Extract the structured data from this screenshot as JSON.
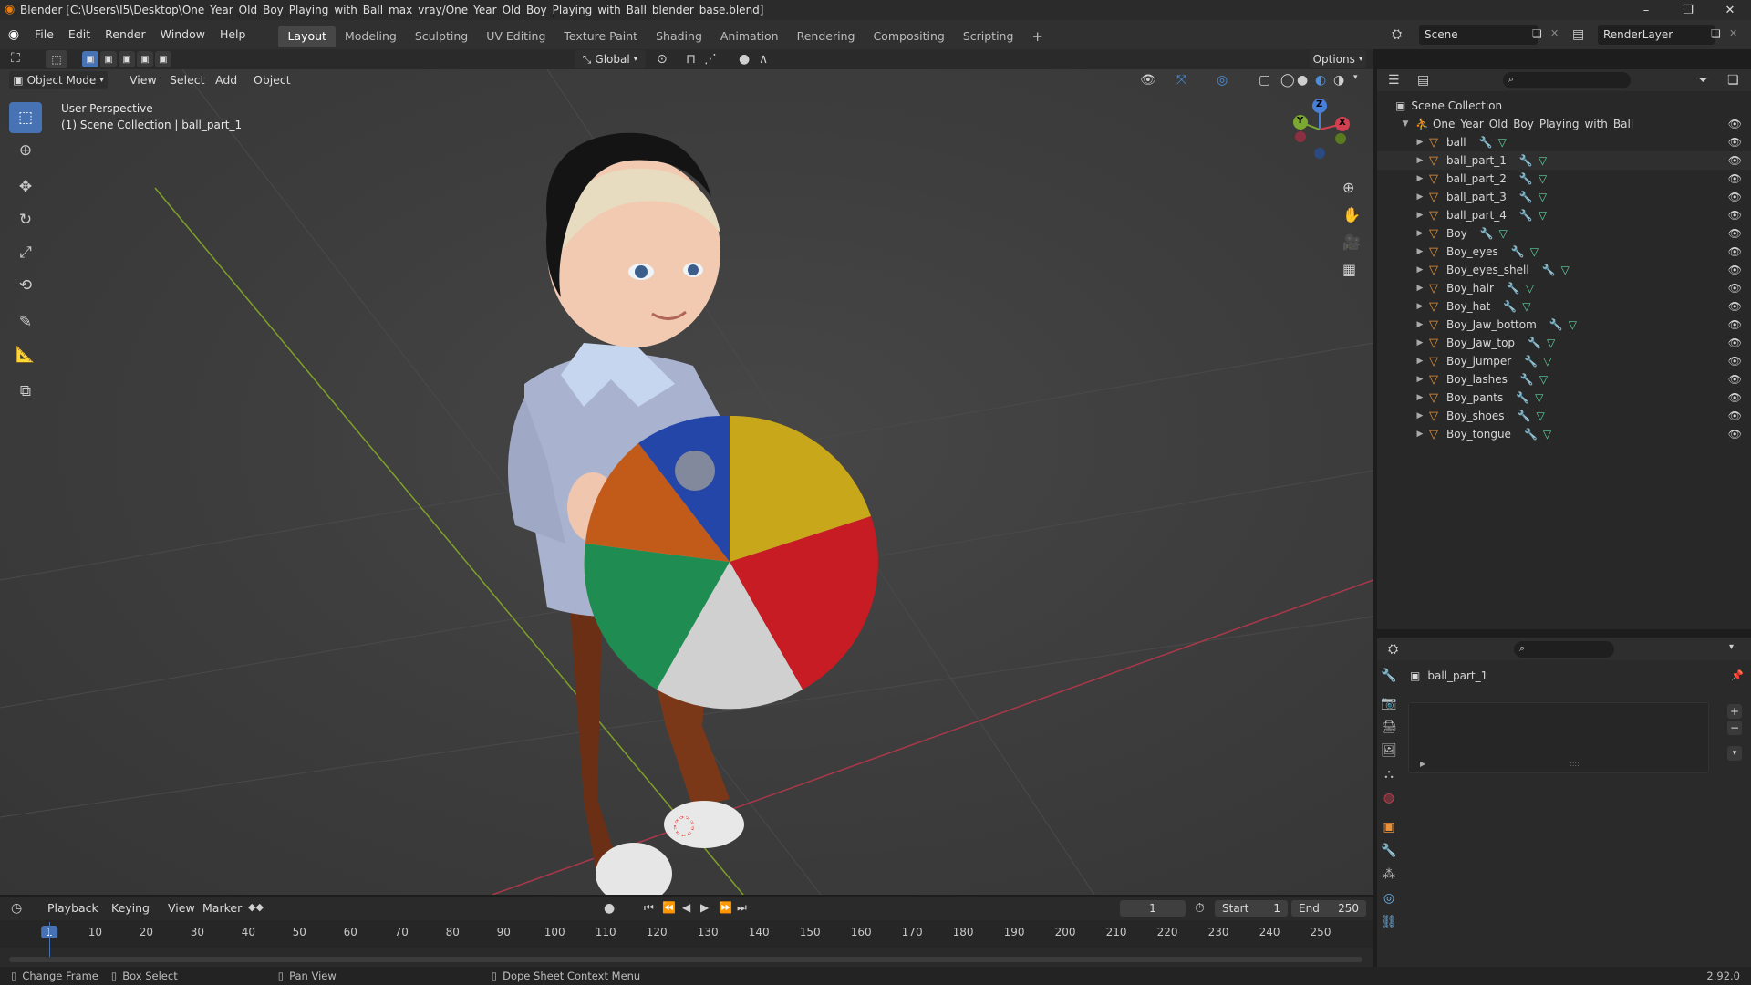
{
  "window": {
    "title": "Blender [C:\\Users\\I5\\Desktop\\One_Year_Old_Boy_Playing_with_Ball_max_vray/One_Year_Old_Boy_Playing_with_Ball_blender_base.blend]",
    "minimize": "–",
    "maximize": "❐",
    "close": "✕"
  },
  "menu": [
    "File",
    "Edit",
    "Render",
    "Window",
    "Help"
  ],
  "workspaces": [
    "Layout",
    "Modeling",
    "Sculpting",
    "UV Editing",
    "Texture Paint",
    "Shading",
    "Animation",
    "Rendering",
    "Compositing",
    "Scripting"
  ],
  "workspace_add": "+",
  "scene": {
    "name": "Scene",
    "render_layer": "RenderLayer"
  },
  "tool_header": {
    "orientation": "Global",
    "options": "Options"
  },
  "viewport_header": {
    "mode": "Object Mode",
    "menus": [
      "View",
      "Select",
      "Add",
      "Object"
    ]
  },
  "viewport": {
    "perspective": "User Perspective",
    "collection_info": "(1) Scene Collection | ball_part_1",
    "gizmo": {
      "x": "X",
      "y": "Y",
      "z": "Z"
    }
  },
  "outliner": {
    "root": "Scene Collection",
    "collection": "One_Year_Old_Boy_Playing_with_Ball",
    "objects": [
      "ball",
      "ball_part_1",
      "ball_part_2",
      "ball_part_3",
      "ball_part_4",
      "Boy",
      "Boy_eyes",
      "Boy_eyes_shell",
      "Boy_hair",
      "Boy_hat",
      "Boy_Jaw_bottom",
      "Boy_Jaw_top",
      "Boy_jumper",
      "Boy_lashes",
      "Boy_pants",
      "Boy_shoes",
      "Boy_tongue"
    ]
  },
  "properties": {
    "object_name": "ball_part_1",
    "list_grip": "::::"
  },
  "timeline": {
    "menus": [
      "Playback",
      "Keying",
      "View",
      "Marker"
    ],
    "current_frame": "1",
    "start_label": "Start",
    "start": "1",
    "end_label": "End",
    "end": "250",
    "ticks": [
      "1",
      "10",
      "20",
      "30",
      "40",
      "50",
      "60",
      "70",
      "80",
      "90",
      "100",
      "110",
      "120",
      "130",
      "140",
      "150",
      "160",
      "170",
      "180",
      "190",
      "200",
      "210",
      "220",
      "230",
      "240",
      "250"
    ]
  },
  "statusbar": {
    "hints": [
      "Change Frame",
      "Box Select",
      "Pan View",
      "Dope Sheet Context Menu"
    ],
    "version": "2.92.0"
  }
}
